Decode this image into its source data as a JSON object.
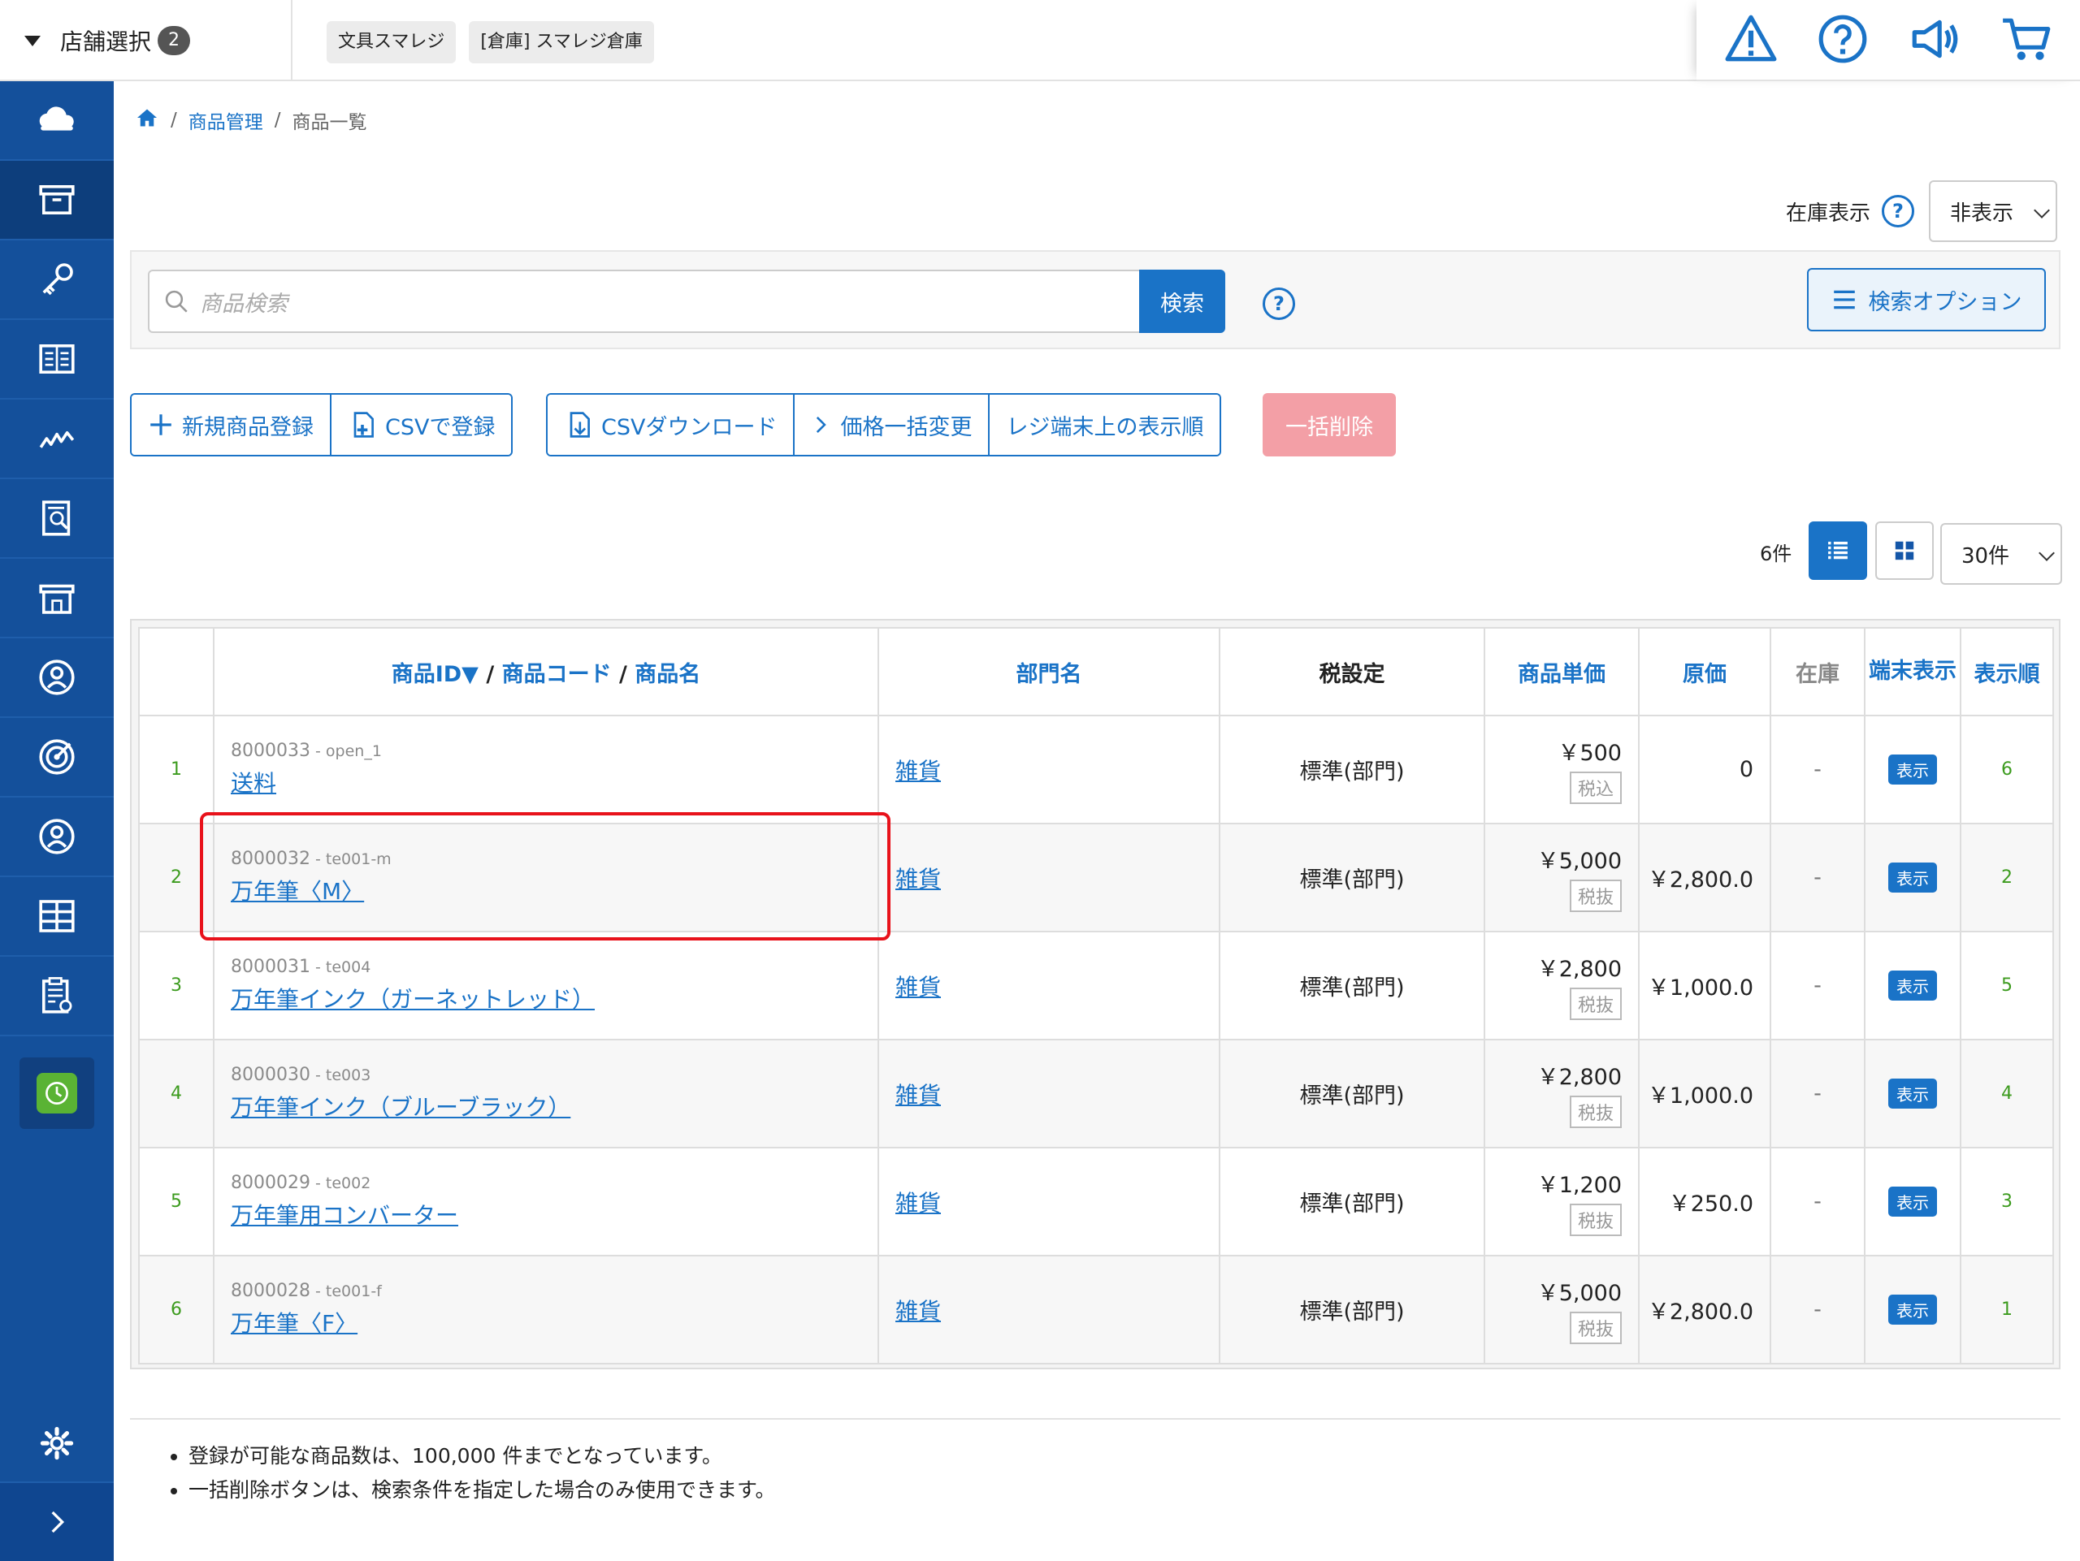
{
  "header": {
    "store_select_label": "店舗選択",
    "store_count": "2",
    "tags": [
      "文具スマレジ",
      "[倉庫] スマレジ倉庫"
    ]
  },
  "breadcrumb": {
    "items": [
      "商品管理",
      "商品一覧"
    ]
  },
  "stock_display": {
    "label": "在庫表示",
    "value": "非表示"
  },
  "search": {
    "placeholder": "商品検索",
    "button": "検索",
    "options_button": "検索オプション"
  },
  "actions": {
    "new_product": "新規商品登録",
    "csv_register": "CSVで登録",
    "csv_download": "CSVダウンロード",
    "bulk_price": "価格一括変更",
    "display_order": "レジ端末上の表示順",
    "bulk_delete": "一括削除"
  },
  "list_controls": {
    "count": "6件",
    "per_page": "30件"
  },
  "table": {
    "headers": {
      "product_id": "商品ID▼",
      "product_code": "商品コード",
      "product_name": "商品名",
      "dept": "部門名",
      "tax": "税設定",
      "unit_price": "商品単価",
      "cost": "原価",
      "stock": "在庫",
      "terminal_display": "端末表示",
      "display_order": "表示順"
    },
    "rows": [
      {
        "no": "1",
        "id": "8000033",
        "code": "open_1",
        "name": "送料",
        "dept": "雑貨",
        "tax": "標準(部門)",
        "price": "￥500",
        "tax_type": "税込",
        "cost": "0",
        "stock": "-",
        "disp": "表示",
        "order": "6"
      },
      {
        "no": "2",
        "id": "8000032",
        "code": "te001-m",
        "name": "万年筆〈M〉",
        "dept": "雑貨",
        "tax": "標準(部門)",
        "price": "￥5,000",
        "tax_type": "税抜",
        "cost": "￥2,800.0",
        "stock": "-",
        "disp": "表示",
        "order": "2"
      },
      {
        "no": "3",
        "id": "8000031",
        "code": "te004",
        "name": "万年筆インク（ガーネットレッド）",
        "dept": "雑貨",
        "tax": "標準(部門)",
        "price": "￥2,800",
        "tax_type": "税抜",
        "cost": "￥1,000.0",
        "stock": "-",
        "disp": "表示",
        "order": "5"
      },
      {
        "no": "4",
        "id": "8000030",
        "code": "te003",
        "name": "万年筆インク（ブルーブラック）",
        "dept": "雑貨",
        "tax": "標準(部門)",
        "price": "￥2,800",
        "tax_type": "税抜",
        "cost": "￥1,000.0",
        "stock": "-",
        "disp": "表示",
        "order": "4"
      },
      {
        "no": "5",
        "id": "8000029",
        "code": "te002",
        "name": "万年筆用コンバーター",
        "dept": "雑貨",
        "tax": "標準(部門)",
        "price": "￥1,200",
        "tax_type": "税抜",
        "cost": "￥250.0",
        "stock": "-",
        "disp": "表示",
        "order": "3"
      },
      {
        "no": "6",
        "id": "8000028",
        "code": "te001-f",
        "name": "万年筆〈F〉",
        "dept": "雑貨",
        "tax": "標準(部門)",
        "price": "￥5,000",
        "tax_type": "税抜",
        "cost": "￥2,800.0",
        "stock": "-",
        "disp": "表示",
        "order": "1"
      }
    ]
  },
  "notes": [
    "登録が可能な商品数は、100,000 件までとなっています。",
    "一括削除ボタンは、検索条件を指定した場合のみ使用できます。"
  ],
  "icons": {
    "sidebar": [
      "cloud-icon",
      "box-icon",
      "key-icon",
      "book-icon",
      "chart-icon",
      "report-icon",
      "store-icon",
      "customer-icon",
      "target-icon",
      "user-icon",
      "grid-icon",
      "clipboard-icon",
      "clock-icon",
      "gear-icon",
      "chevron-right-icon"
    ],
    "header": [
      "warning-icon",
      "help-icon",
      "megaphone-icon",
      "cart-icon"
    ]
  },
  "colors": {
    "primary": "#1a73c7",
    "sidebar": "#14509b",
    "delete": "#f39fa6",
    "highlight": "#e8121b",
    "row_number": "#3c9b1e"
  }
}
